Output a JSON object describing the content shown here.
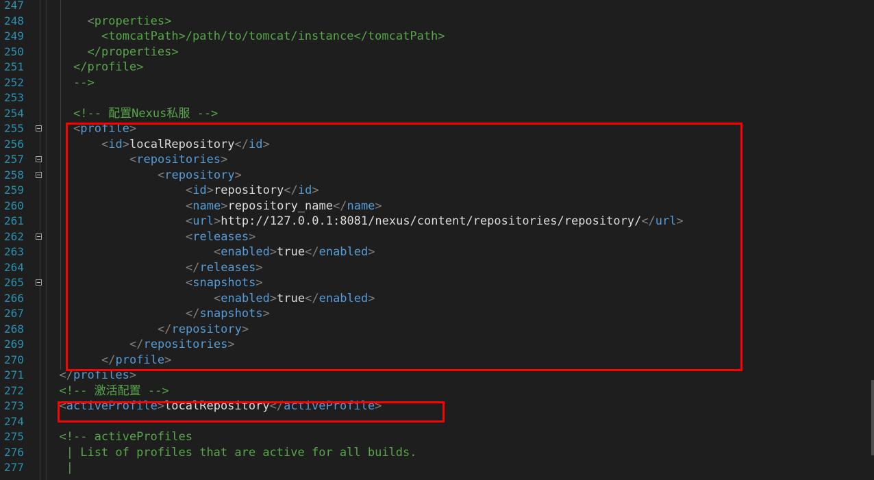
{
  "editor": {
    "language": "xml",
    "colors": {
      "background": "#1e1e1e",
      "line_number": "#2b91af",
      "bracket": "#808080",
      "tag": "#569cd6",
      "comment": "#57a64a",
      "text": "#dcdcdc",
      "highlight_box": "#ff0000"
    },
    "lines": [
      {
        "n": "247",
        "fold": false,
        "indent": 0,
        "parts": []
      },
      {
        "n": "248",
        "fold": false,
        "indent": 6,
        "parts": [
          {
            "k": "g",
            "v": "<"
          },
          {
            "k": "c",
            "v": "properties"
          },
          {
            "k": "c",
            "v": ">"
          }
        ]
      },
      {
        "n": "249",
        "fold": false,
        "indent": 8,
        "parts": [
          {
            "k": "c",
            "v": "<tomcatPath>/path/to/tomcat/instance</tomcatPath>"
          }
        ]
      },
      {
        "n": "250",
        "fold": false,
        "indent": 6,
        "parts": [
          {
            "k": "c",
            "v": "</properties>"
          }
        ]
      },
      {
        "n": "251",
        "fold": false,
        "indent": 4,
        "parts": [
          {
            "k": "c",
            "v": "</profile>"
          }
        ]
      },
      {
        "n": "252",
        "fold": false,
        "indent": 4,
        "parts": [
          {
            "k": "c",
            "v": "-->"
          }
        ]
      },
      {
        "n": "253",
        "fold": false,
        "indent": 0,
        "parts": []
      },
      {
        "n": "254",
        "fold": false,
        "indent": 4,
        "parts": [
          {
            "k": "c",
            "v": "<!-- 配置Nexus私服 -->"
          }
        ]
      },
      {
        "n": "255",
        "fold": true,
        "indent": 4,
        "parts": [
          {
            "k": "g",
            "v": "<"
          },
          {
            "k": "t",
            "v": "profile"
          },
          {
            "k": "g",
            "v": ">"
          }
        ]
      },
      {
        "n": "256",
        "fold": false,
        "indent": 8,
        "parts": [
          {
            "k": "g",
            "v": "<"
          },
          {
            "k": "t",
            "v": "id"
          },
          {
            "k": "g",
            "v": ">"
          },
          {
            "k": "x",
            "v": "localRepository"
          },
          {
            "k": "g",
            "v": "</"
          },
          {
            "k": "t",
            "v": "id"
          },
          {
            "k": "g",
            "v": ">"
          }
        ]
      },
      {
        "n": "257",
        "fold": true,
        "indent": 12,
        "parts": [
          {
            "k": "g",
            "v": "<"
          },
          {
            "k": "t",
            "v": "repositories"
          },
          {
            "k": "g",
            "v": ">"
          }
        ]
      },
      {
        "n": "258",
        "fold": true,
        "indent": 16,
        "parts": [
          {
            "k": "g",
            "v": "<"
          },
          {
            "k": "t",
            "v": "repository"
          },
          {
            "k": "g",
            "v": ">"
          }
        ]
      },
      {
        "n": "259",
        "fold": false,
        "indent": 20,
        "parts": [
          {
            "k": "g",
            "v": "<"
          },
          {
            "k": "t",
            "v": "id"
          },
          {
            "k": "g",
            "v": ">"
          },
          {
            "k": "x",
            "v": "repository"
          },
          {
            "k": "g",
            "v": "</"
          },
          {
            "k": "t",
            "v": "id"
          },
          {
            "k": "g",
            "v": ">"
          }
        ]
      },
      {
        "n": "260",
        "fold": false,
        "indent": 20,
        "parts": [
          {
            "k": "g",
            "v": "<"
          },
          {
            "k": "t",
            "v": "name"
          },
          {
            "k": "g",
            "v": ">"
          },
          {
            "k": "x",
            "v": "repository_name"
          },
          {
            "k": "g",
            "v": "</"
          },
          {
            "k": "t",
            "v": "name"
          },
          {
            "k": "g",
            "v": ">"
          }
        ]
      },
      {
        "n": "261",
        "fold": false,
        "indent": 20,
        "parts": [
          {
            "k": "g",
            "v": "<"
          },
          {
            "k": "t",
            "v": "url"
          },
          {
            "k": "g",
            "v": ">"
          },
          {
            "k": "x",
            "v": "http://127.0.0.1:8081/nexus/content/repositories/repository/"
          },
          {
            "k": "g",
            "v": "</"
          },
          {
            "k": "t",
            "v": "url"
          },
          {
            "k": "g",
            "v": ">"
          }
        ]
      },
      {
        "n": "262",
        "fold": true,
        "indent": 20,
        "parts": [
          {
            "k": "g",
            "v": "<"
          },
          {
            "k": "t",
            "v": "releases"
          },
          {
            "k": "g",
            "v": ">"
          }
        ]
      },
      {
        "n": "263",
        "fold": false,
        "indent": 24,
        "parts": [
          {
            "k": "g",
            "v": "<"
          },
          {
            "k": "t",
            "v": "enabled"
          },
          {
            "k": "g",
            "v": ">"
          },
          {
            "k": "x",
            "v": "true"
          },
          {
            "k": "g",
            "v": "</"
          },
          {
            "k": "t",
            "v": "enabled"
          },
          {
            "k": "g",
            "v": ">"
          }
        ]
      },
      {
        "n": "264",
        "fold": false,
        "indent": 20,
        "parts": [
          {
            "k": "g",
            "v": "</"
          },
          {
            "k": "t",
            "v": "releases"
          },
          {
            "k": "g",
            "v": ">"
          }
        ]
      },
      {
        "n": "265",
        "fold": true,
        "indent": 20,
        "parts": [
          {
            "k": "g",
            "v": "<"
          },
          {
            "k": "t",
            "v": "snapshots"
          },
          {
            "k": "g",
            "v": ">"
          }
        ]
      },
      {
        "n": "266",
        "fold": false,
        "indent": 24,
        "parts": [
          {
            "k": "g",
            "v": "<"
          },
          {
            "k": "t",
            "v": "enabled"
          },
          {
            "k": "g",
            "v": ">"
          },
          {
            "k": "x",
            "v": "true"
          },
          {
            "k": "g",
            "v": "</"
          },
          {
            "k": "t",
            "v": "enabled"
          },
          {
            "k": "g",
            "v": ">"
          }
        ]
      },
      {
        "n": "267",
        "fold": false,
        "indent": 20,
        "parts": [
          {
            "k": "g",
            "v": "</"
          },
          {
            "k": "t",
            "v": "snapshots"
          },
          {
            "k": "g",
            "v": ">"
          }
        ]
      },
      {
        "n": "268",
        "fold": false,
        "indent": 16,
        "parts": [
          {
            "k": "g",
            "v": "</"
          },
          {
            "k": "t",
            "v": "repository"
          },
          {
            "k": "g",
            "v": ">"
          }
        ]
      },
      {
        "n": "269",
        "fold": false,
        "indent": 12,
        "parts": [
          {
            "k": "g",
            "v": "</"
          },
          {
            "k": "t",
            "v": "repositories"
          },
          {
            "k": "g",
            "v": ">"
          }
        ]
      },
      {
        "n": "270",
        "fold": false,
        "indent": 8,
        "parts": [
          {
            "k": "g",
            "v": "</"
          },
          {
            "k": "t",
            "v": "profile"
          },
          {
            "k": "g",
            "v": ">"
          }
        ]
      },
      {
        "n": "271",
        "fold": false,
        "indent": 2,
        "parts": [
          {
            "k": "g",
            "v": "</"
          },
          {
            "k": "t",
            "v": "profiles"
          },
          {
            "k": "g",
            "v": ">"
          }
        ]
      },
      {
        "n": "272",
        "fold": false,
        "indent": 2,
        "parts": [
          {
            "k": "c",
            "v": "<!-- 激活配置 -->"
          }
        ]
      },
      {
        "n": "273",
        "fold": false,
        "indent": 2,
        "parts": [
          {
            "k": "g",
            "v": "<"
          },
          {
            "k": "t",
            "v": "activeProfile"
          },
          {
            "k": "g",
            "v": ">"
          },
          {
            "k": "x",
            "v": "localRepository"
          },
          {
            "k": "g",
            "v": "</"
          },
          {
            "k": "t",
            "v": "activeProfile"
          },
          {
            "k": "g",
            "v": ">"
          }
        ]
      },
      {
        "n": "274",
        "fold": false,
        "indent": 0,
        "parts": []
      },
      {
        "n": "275",
        "fold": false,
        "indent": 2,
        "parts": [
          {
            "k": "c",
            "v": "<!-- activeProfiles"
          }
        ]
      },
      {
        "n": "276",
        "fold": false,
        "indent": 3,
        "parts": [
          {
            "k": "c",
            "v": "| List of profiles that are active for all builds."
          }
        ]
      },
      {
        "n": "277",
        "fold": false,
        "indent": 3,
        "parts": [
          {
            "k": "c",
            "v": "|"
          }
        ]
      }
    ]
  }
}
